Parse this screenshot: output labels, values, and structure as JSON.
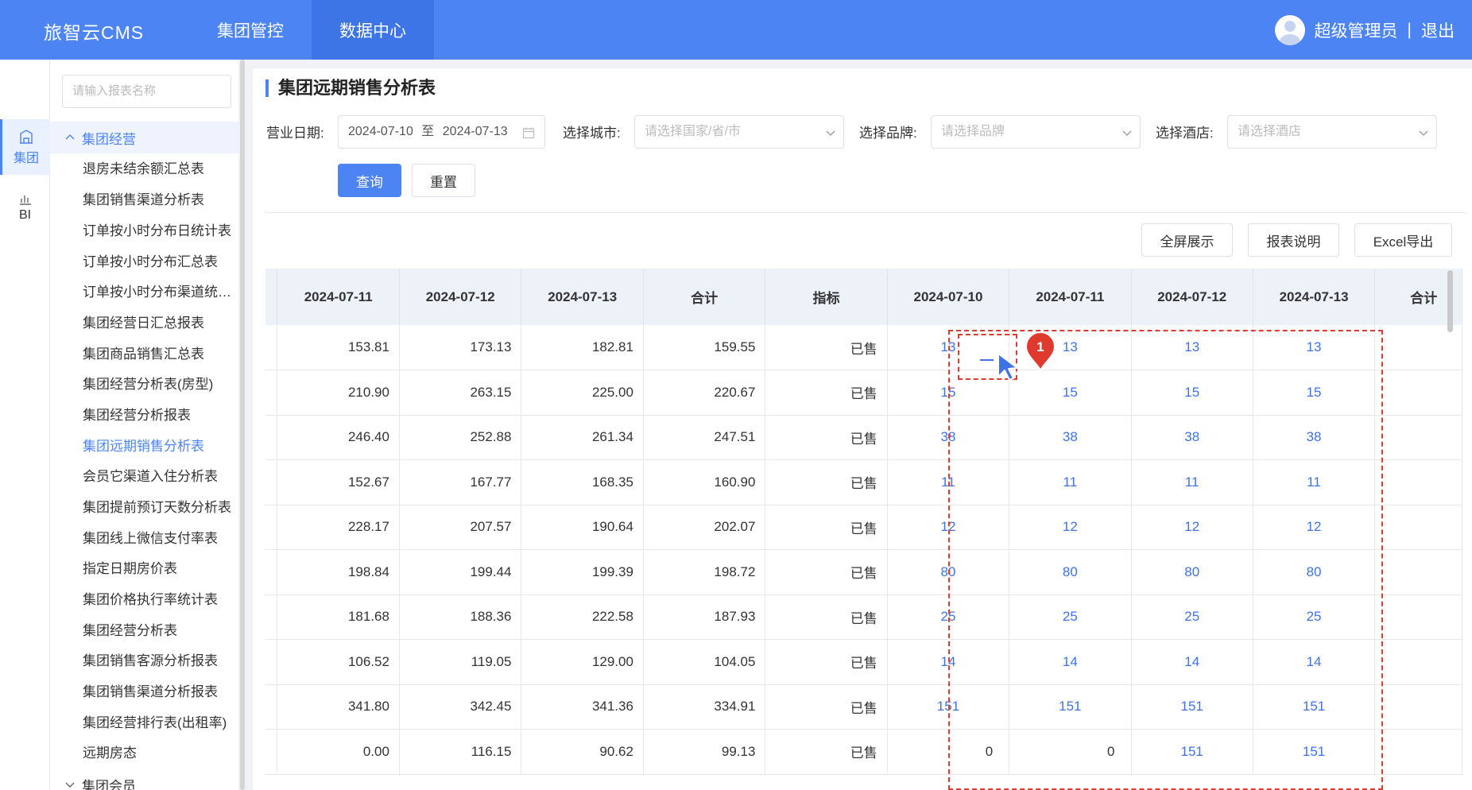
{
  "header": {
    "brand": "旅智云CMS",
    "nav": [
      "集团管控",
      "数据中心"
    ],
    "user_name": "超级管理员",
    "separator": "|",
    "logout": "退出"
  },
  "rail": [
    {
      "label": "集团",
      "icon": "building-icon"
    },
    {
      "label": "BI",
      "icon": "bar-chart-icon"
    }
  ],
  "sidebar": {
    "search_placeholder": "请输入报表名称",
    "group1": "集团经营",
    "items": [
      "退房未结余额汇总表",
      "集团销售渠道分析表",
      "订单按小时分布日统计表",
      "订单按小时分布汇总表",
      "订单按小时分布渠道统计表",
      "集团经营日汇总报表",
      "集团商品销售汇总表",
      "集团经营分析表(房型)",
      "集团经营分析报表",
      "集团远期销售分析表",
      "会员它渠道入住分析表",
      "集团提前预订天数分析表",
      "集团线上微信支付率表",
      "指定日期房价表",
      "集团价格执行率统计表",
      "集团经营分析表",
      "集团销售客源分析报表",
      "集团销售渠道分析报表",
      "集团经营排行表(出租率)",
      "远期房态"
    ],
    "group2": "集团会员"
  },
  "page": {
    "title": "集团远期销售分析表",
    "filters": {
      "date_label": "营业日期:",
      "date_start": "2024-07-10",
      "date_sep": "至",
      "date_end": "2024-07-13",
      "city_label": "选择城市:",
      "city_placeholder": "请选择国家/省/市",
      "brand_label": "选择品牌:",
      "brand_placeholder": "请选择品牌",
      "hotel_label": "选择酒店:",
      "hotel_placeholder": "请选择酒店"
    },
    "query_button": "查询",
    "reset_button": "重置",
    "fullscreen_button": "全屏展示",
    "report_desc_button": "报表说明",
    "excel_button": "Excel导出"
  },
  "table": {
    "headers": [
      "2024-07-11",
      "2024-07-12",
      "2024-07-13",
      "合计",
      "指标",
      "2024-07-10",
      "2024-07-11",
      "2024-07-12",
      "2024-07-13",
      "合计"
    ],
    "rows": [
      [
        "153.81",
        "173.13",
        "182.81",
        "159.55",
        "已售",
        "13",
        "13",
        "13",
        "13"
      ],
      [
        "210.90",
        "263.15",
        "225.00",
        "220.67",
        "已售",
        "15",
        "15",
        "15",
        "15"
      ],
      [
        "246.40",
        "252.88",
        "261.34",
        "247.51",
        "已售",
        "38",
        "38",
        "38",
        "38"
      ],
      [
        "152.67",
        "167.77",
        "168.35",
        "160.90",
        "已售",
        "11",
        "11",
        "11",
        "11"
      ],
      [
        "228.17",
        "207.57",
        "190.64",
        "202.07",
        "已售",
        "12",
        "12",
        "12",
        "12"
      ],
      [
        "198.84",
        "199.44",
        "199.39",
        "198.72",
        "已售",
        "80",
        "80",
        "80",
        "80"
      ],
      [
        "181.68",
        "188.36",
        "222.58",
        "187.93",
        "已售",
        "25",
        "25",
        "25",
        "25"
      ],
      [
        "106.52",
        "119.05",
        "129.00",
        "104.05",
        "已售",
        "14",
        "14",
        "14",
        "14"
      ],
      [
        "341.80",
        "342.45",
        "341.36",
        "334.91",
        "已售",
        "151",
        "151",
        "151",
        "151"
      ],
      [
        "0.00",
        "116.15",
        "90.62",
        "99.13",
        "已售",
        "0",
        "0",
        "151",
        "151"
      ]
    ]
  },
  "annotation": {
    "badge": "1"
  },
  "colors": {
    "primary": "#4c84f3",
    "highlight": "#e03a2f",
    "link": "#3e72e6"
  }
}
